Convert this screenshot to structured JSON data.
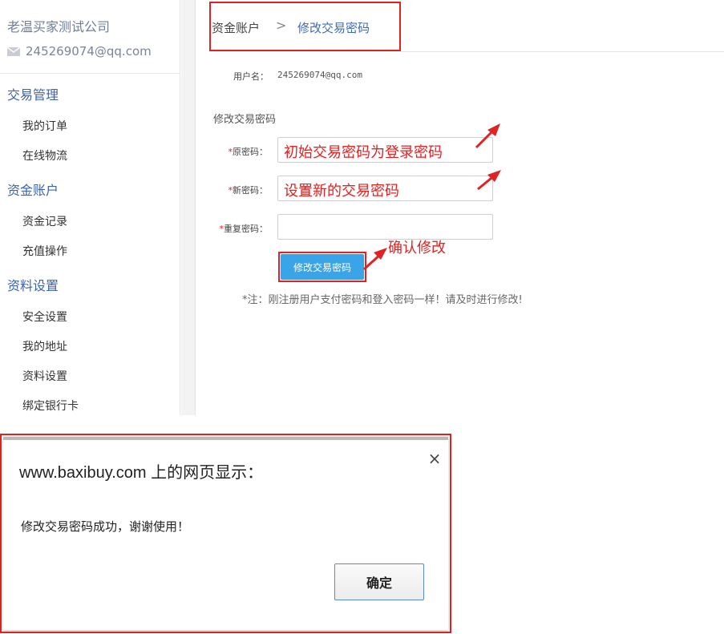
{
  "sidebar": {
    "company": "老温买家测试公司",
    "email": "245269074@qq.com",
    "groups": [
      {
        "label": "交易管理",
        "items": [
          "我的订单",
          "在线物流"
        ]
      },
      {
        "label": "资金账户",
        "items": [
          "资金记录",
          "充值操作"
        ]
      },
      {
        "label": "资料设置",
        "items": [
          "安全设置",
          "我的地址",
          "资料设置",
          "绑定银行卡"
        ]
      }
    ]
  },
  "breadcrumb": {
    "root": "资金账户",
    "separator": ">",
    "current": "修改交易密码"
  },
  "form": {
    "username_label": "用户名：",
    "username_value": "245269074@qq.com",
    "section_title": "修改交易密码",
    "required_mark": "*",
    "fields": [
      {
        "label": "原密码：",
        "annotation": "初始交易密码为登录密码"
      },
      {
        "label": "新密码：",
        "annotation": "设置新的交易密码"
      },
      {
        "label": "重复密码：",
        "annotation": ""
      }
    ],
    "submit_label": "修改交易密码",
    "submit_annotation": "确认修改",
    "note": "*注：刚注册用户支付密码和登入密码一样！请及时进行修改!"
  },
  "dialog": {
    "title": "www.baxibuy.com 上的网页显示：",
    "close": "×",
    "message": "修改交易密码成功，谢谢使用！",
    "ok_label": "确定"
  },
  "colors": {
    "accent": "#3e6bb8",
    "highlight": "#e02222",
    "button": "#3aa4e8"
  }
}
